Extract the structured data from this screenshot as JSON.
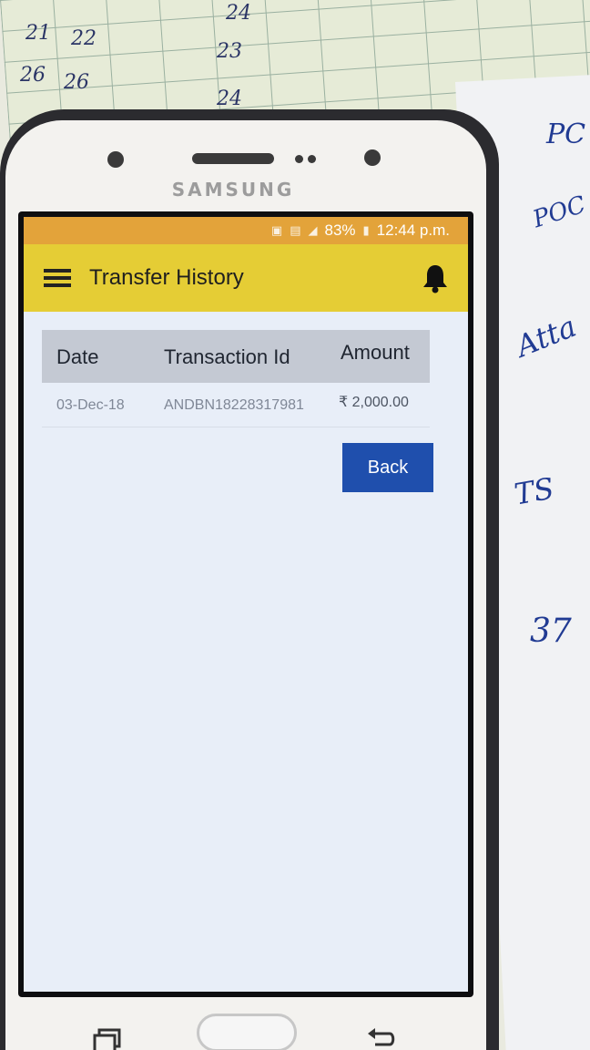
{
  "status_bar": {
    "battery": "83%",
    "time": "12:44 p.m."
  },
  "app": {
    "title": "Transfer History"
  },
  "table": {
    "headers": [
      "Date",
      "Transaction Id",
      "Amount"
    ],
    "rows": [
      {
        "date": "03-Dec-18",
        "transaction_id": "ANDBN18228317981",
        "amount": "₹ 2,000.00"
      }
    ]
  },
  "actions": {
    "back_label": "Back"
  },
  "device": {
    "brand": "SAMSUNG"
  },
  "background": {
    "grid_numbers": [
      "24",
      "21",
      "22",
      "23",
      "26",
      "26",
      "24"
    ],
    "note_words": [
      "PC",
      "POC",
      "Atta",
      "TS",
      "37"
    ]
  },
  "colors": {
    "status_bar": "#e3a33a",
    "app_bar": "#e5cd35",
    "table_header": "#c4c9d3",
    "back_button": "#1f4fad",
    "screen_bg": "#e8eef8"
  }
}
